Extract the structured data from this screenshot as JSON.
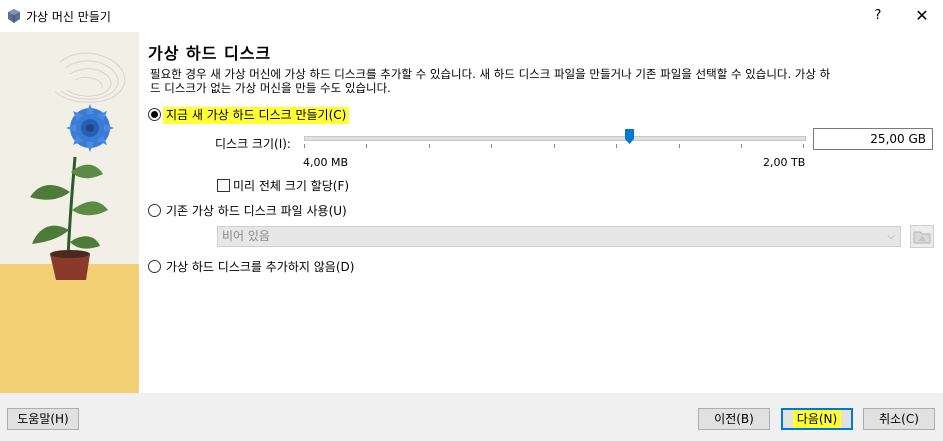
{
  "window": {
    "title": "가상 머신 만들기",
    "help_glyph": "?",
    "close_glyph": "✕"
  },
  "page": {
    "heading": "가상 하드 디스크",
    "description": "필요한 경우 새 가상 머신에 가상 하드 디스크를 추가할 수 있습니다. 새 하드 디스크 파일을 만들거나 기존 파일을 선택할 수 있습니다. 가상 하드 디스크가 없는 가상 머신을 만들 수도 있습니다."
  },
  "options": {
    "create_new": {
      "label": "지금 새 가상 하드 디스크 만들기(C)",
      "checked": true
    },
    "use_existing": {
      "label": "기존 가상 하드 디스크 파일 사용(U)",
      "checked": false
    },
    "no_disk": {
      "label": "가상 하드 디스크를 추가하지 않음(D)",
      "checked": false
    }
  },
  "disk_size": {
    "label": "디스크 크기(I):",
    "value": "25,00 GB",
    "min_label": "4,00 MB",
    "max_label": "2,00 TB",
    "slider_fraction": 0.65
  },
  "preallocate": {
    "label": "미리 전체 크기 할당(F)",
    "checked": false
  },
  "existing_file": {
    "value": "비어 있음",
    "enabled": false
  },
  "footer": {
    "help": "도움말(H)",
    "back": "이전(B)",
    "next": "다음(N)",
    "cancel": "취소(C)"
  },
  "colors": {
    "highlight": "#ffff33",
    "accent": "#0078d7",
    "flower": "#3a7bd5",
    "wall": "#f2efe7",
    "floor": "#f1cf72"
  },
  "icons": {
    "app": "virtualbox-icon",
    "folder": "folder-icon"
  }
}
